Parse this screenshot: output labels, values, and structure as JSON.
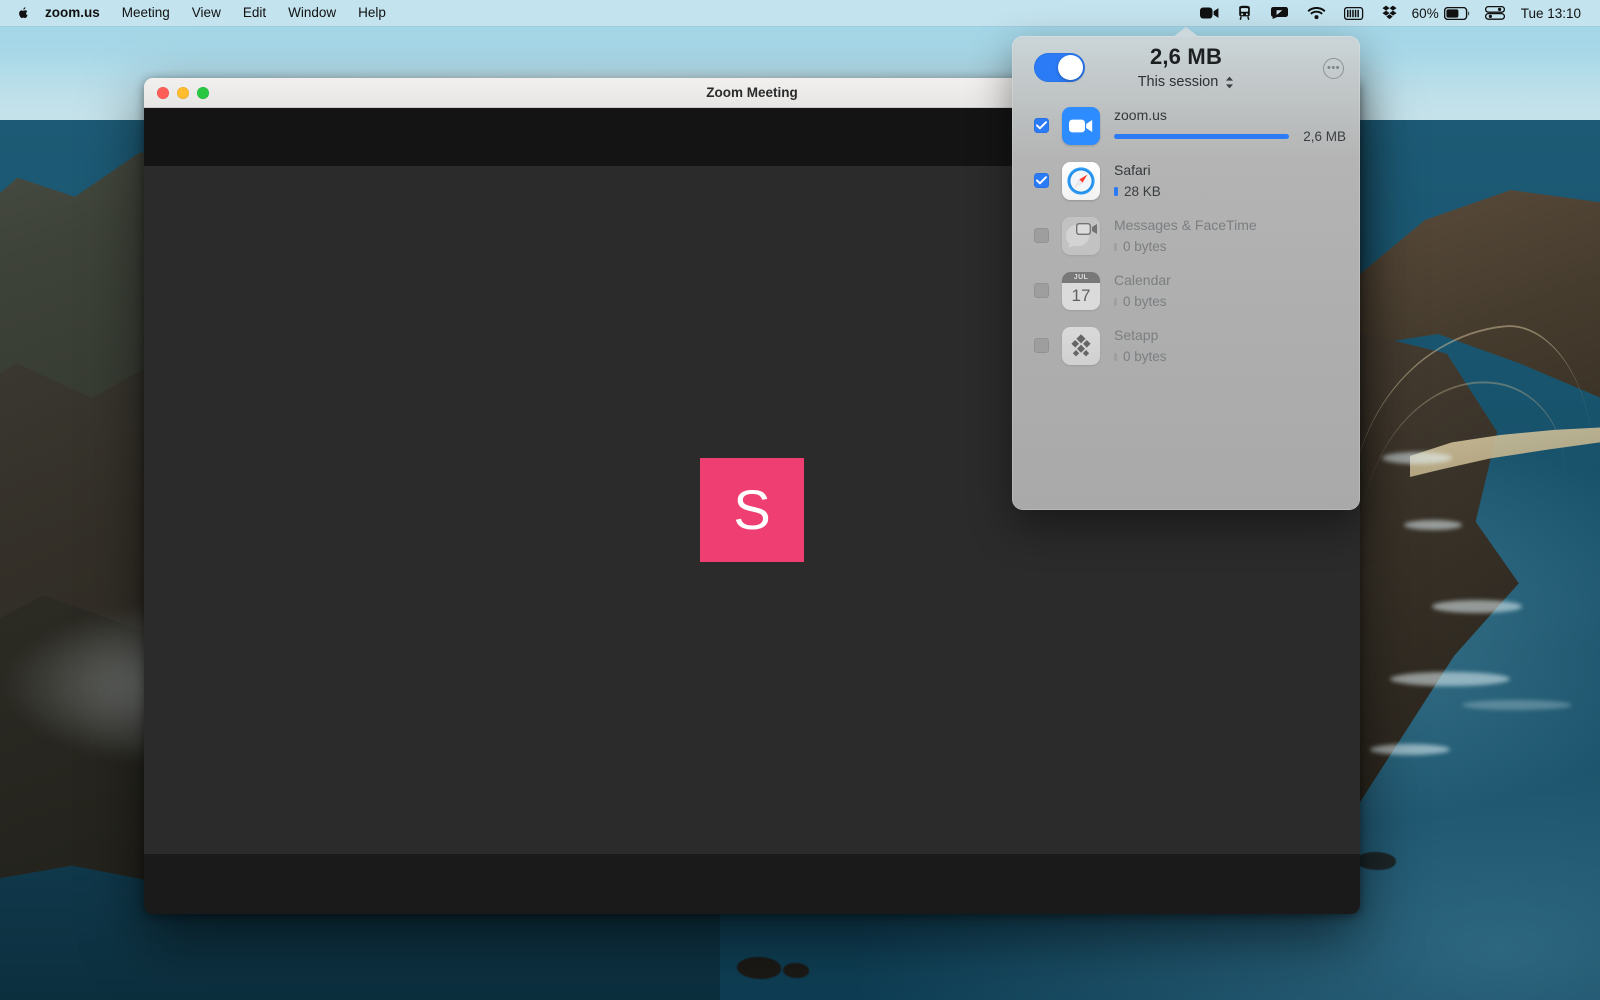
{
  "menubar": {
    "apple_icon": "apple-logo-icon",
    "app_name": "zoom.us",
    "menus": [
      "Meeting",
      "View",
      "Edit",
      "Window",
      "Help"
    ],
    "status_icons": [
      "zoom-video-icon",
      "tripmode-icon",
      "screen-share-icon",
      "wifi-icon",
      "battery-meter-icon",
      "dropbox-icon"
    ],
    "battery_percent": "60%",
    "control_center_icon": "control-center-icon",
    "clock": "Tue 13:10"
  },
  "zoom_window": {
    "title": "Zoom Meeting",
    "traffic_lights": [
      "close-button",
      "minimize-button",
      "zoom-button"
    ],
    "stage_logo_letter": "S",
    "stage_logo_color": "#ef3f72"
  },
  "tripmode_panel": {
    "toggle_on": true,
    "total_usage": "2,6 MB",
    "session_label": "This session",
    "session_stepper_icon": "stepper-updown-icon",
    "more_button_icon": "ellipsis-icon",
    "apps": [
      {
        "name": "zoom.us",
        "size": "2,6 MB",
        "checked": true,
        "icon": "zoom-app-icon",
        "bar_pct": 100,
        "bar_style": "full"
      },
      {
        "name": "Safari",
        "size": "28 KB",
        "checked": true,
        "icon": "safari-app-icon",
        "bar_pct": 2,
        "bar_style": "tiny"
      },
      {
        "name": "Messages & FaceTime",
        "size": "0 bytes",
        "checked": false,
        "icon": "messages-facetime-app-icon",
        "bar_pct": 0,
        "bar_style": "none"
      },
      {
        "name": "Calendar",
        "size": "0 bytes",
        "checked": false,
        "icon": "calendar-app-icon",
        "bar_pct": 0,
        "bar_style": "none",
        "cal_month": "JUL",
        "cal_day": "17"
      },
      {
        "name": "Setapp",
        "size": "0 bytes",
        "checked": false,
        "icon": "setapp-app-icon",
        "bar_pct": 0,
        "bar_style": "none"
      }
    ]
  },
  "colors": {
    "accent_blue": "#2b7bf6",
    "setapp_pink": "#ef3f72",
    "menubar_tint": "#cde7f0"
  }
}
